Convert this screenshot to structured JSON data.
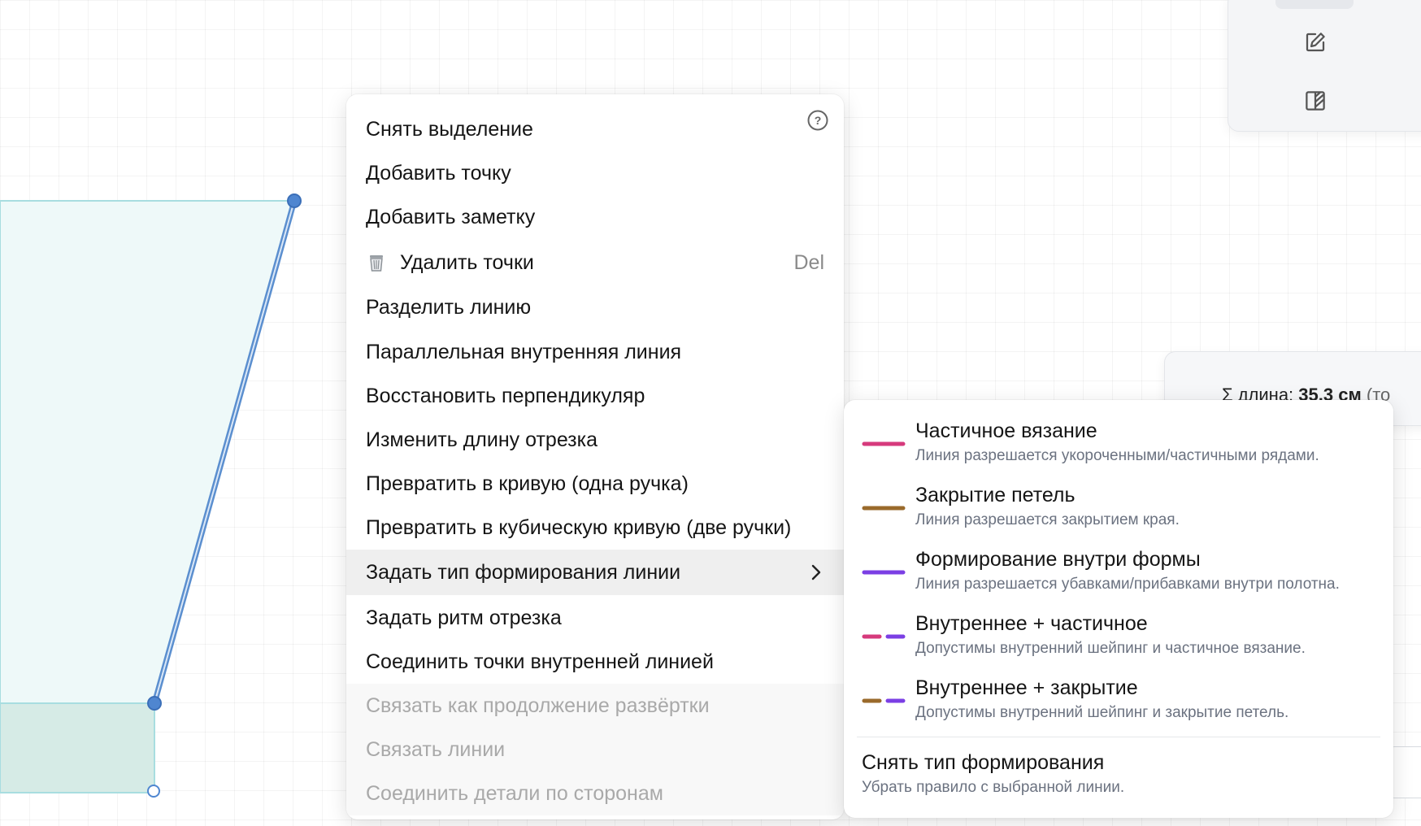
{
  "context_menu": {
    "items": [
      {
        "label": "Снять выделение"
      },
      {
        "label": "Добавить точку"
      },
      {
        "label": "Добавить заметку"
      },
      {
        "label": "Удалить точки",
        "shortcut": "Del",
        "icon": "trash-icon"
      },
      {
        "label": "Разделить линию"
      },
      {
        "label": "Параллельная внутренняя линия"
      },
      {
        "label": "Восстановить перпендикуляр"
      },
      {
        "label": "Изменить длину отрезка"
      },
      {
        "label": "Превратить в кривую (одна ручка)"
      },
      {
        "label": "Превратить в кубическую кривую (две ручки)"
      },
      {
        "label": "Задать тип формирования линии",
        "state": "active",
        "icon": "chevron-right-icon"
      },
      {
        "label": "Задать ритм отрезка"
      },
      {
        "label": "Соединить точки внутренней линией"
      },
      {
        "label": "Связать как продолжение развёртки",
        "state": "disabled"
      },
      {
        "label": "Связать линии",
        "state": "disabled"
      },
      {
        "label": "Соединить детали по сторонам",
        "state": "disabled"
      }
    ]
  },
  "submenu": {
    "items": [
      {
        "title": "Частичное вязание",
        "desc": "Линия разрешается укороченными/частичными рядами.",
        "colors": [
          "#d63a7c"
        ],
        "style": "solid"
      },
      {
        "title": "Закрытие петель",
        "desc": "Линия разрешается закрытием края.",
        "colors": [
          "#9a6a2b"
        ],
        "style": "solid"
      },
      {
        "title": "Формирование внутри формы",
        "desc": "Линия разрешается убавками/прибавками внутри полотна.",
        "colors": [
          "#7b3fe4"
        ],
        "style": "solid"
      },
      {
        "title": "Внутреннее + частичное",
        "desc": "Допустимы внутренний шейпинг и частичное вязание.",
        "colors": [
          "#d63a7c",
          "#7b3fe4"
        ],
        "style": "dashed"
      },
      {
        "title": "Внутреннее + закрытие",
        "desc": "Допустимы внутренний шейпинг и закрытие петель.",
        "colors": [
          "#9a6a2b",
          "#7b3fe4"
        ],
        "style": "dashed"
      }
    ],
    "clear": {
      "title": "Снять тип формирования",
      "desc": "Убрать правило с выбранной линии."
    }
  },
  "length_panel": {
    "prefix": "Σ длина: ",
    "value": "35.3 см",
    "suffix": " (то"
  },
  "toolbar": {
    "icons": [
      "pencil-edit-icon",
      "layout-split-icon"
    ]
  },
  "colors": {
    "shape_fill": "#eef9f9",
    "shape_stroke": "#a8dde0",
    "line": "#5b8fcf",
    "point": "#4f86d0"
  }
}
